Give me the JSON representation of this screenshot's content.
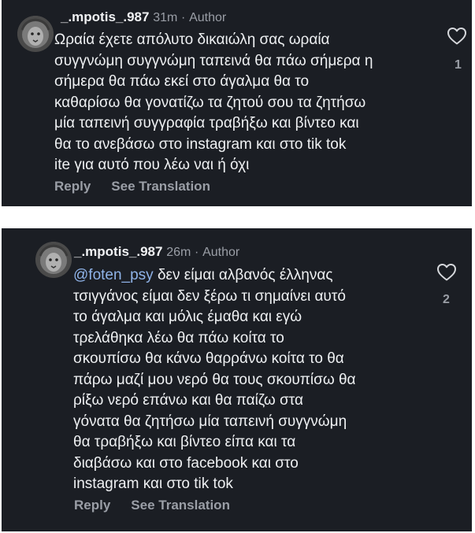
{
  "comments": [
    {
      "username": "_.mpotis_.987",
      "time": "31m",
      "separator": "·",
      "role": "Author",
      "mention": "",
      "text": "Ωραία έχετε απόλυτο δικαιώλη σας ωραία\nσυγγνώμη συγγνώμη ταπεινά θα πάω σήμερα η\nσήμερα θα πάω εκεί στο άγαλμα θα το\nκαθαρίσω θα γονατίζω τα ζητού σου τα ζητήσω\nμία ταπεινή συγγραφία τραβήξω και βίντεο και\nθα το ανεβάσω στο instagram και στο tik tok\nite για αυτό που λέω ναι ή όχι",
      "reply_label": "Reply",
      "translate_label": "See Translation",
      "like_count": "1",
      "avatar_icon": "lion-avatar-icon",
      "like_icon": "heart-outline-icon"
    },
    {
      "username": "_.mpotis_.987",
      "time": "26m",
      "separator": "·",
      "role": "Author",
      "mention": "@foten_psy",
      "text": " δεν είμαι αλβανός έλληνας\nτσιγγάνος είμαι δεν ξέρω τι σημαίνει αυτό\nτο άγαλμα και μόλις έμαθα και εγώ\nτρελάθηκα λέω θα πάω κοίτα το\nσκουπίσω θα κάνω θαρράνω κοίτα το θα\nπάρω μαζί μου νερό θα τους σκουπίσω θα\nρίξω νερό επάνω και θα παίζω στα\nγόνατα θα ζητήσω μία ταπεινή συγγνώμη\nθα τραβήξω και βίντεο είπα και τα\nδιαβάσω και στο facebook και στο\ninstagram και στο tik tok",
      "reply_label": "Reply",
      "translate_label": "See Translation",
      "like_count": "2",
      "avatar_icon": "lion-avatar-icon",
      "like_icon": "heart-outline-icon"
    }
  ],
  "colors": {
    "card_background": "#1b1e24",
    "text": "#eef0f2",
    "secondary": "#9a9ea6",
    "mention": "#8fb3e8",
    "page_background": "#ffffff"
  }
}
